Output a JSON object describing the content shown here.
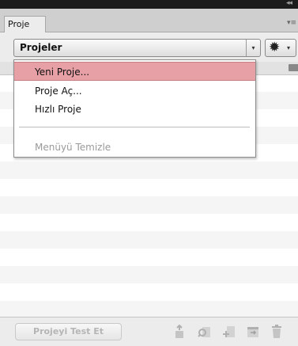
{
  "window": {
    "collapse_glyph": "◂◂"
  },
  "panel": {
    "tab_label": "Proje",
    "menu_glyph": "▾≡"
  },
  "toolbar": {
    "site_select_value": "Projeler",
    "select_arrow_glyph": "▾",
    "gear_glyph": "✹",
    "gear_arrow_glyph": "▾"
  },
  "dropdown": {
    "items": [
      {
        "label": "Yeni Proje...",
        "highlighted": true
      },
      {
        "label": "Proje Aç...",
        "highlighted": false
      },
      {
        "label": "Hızlı Proje",
        "highlighted": false
      },
      {
        "label": "Menüyü Temizle",
        "disabled": true
      }
    ]
  },
  "footer": {
    "test_button_label": "Projeyi Test Et",
    "icons": [
      "upload-icon",
      "search-file-icon",
      "add-file-icon",
      "sync-icon",
      "trash-icon"
    ]
  },
  "colors": {
    "highlight": "#e8a0a7",
    "titlebar": "#1c1c1c",
    "panel_bg": "#ececec"
  }
}
